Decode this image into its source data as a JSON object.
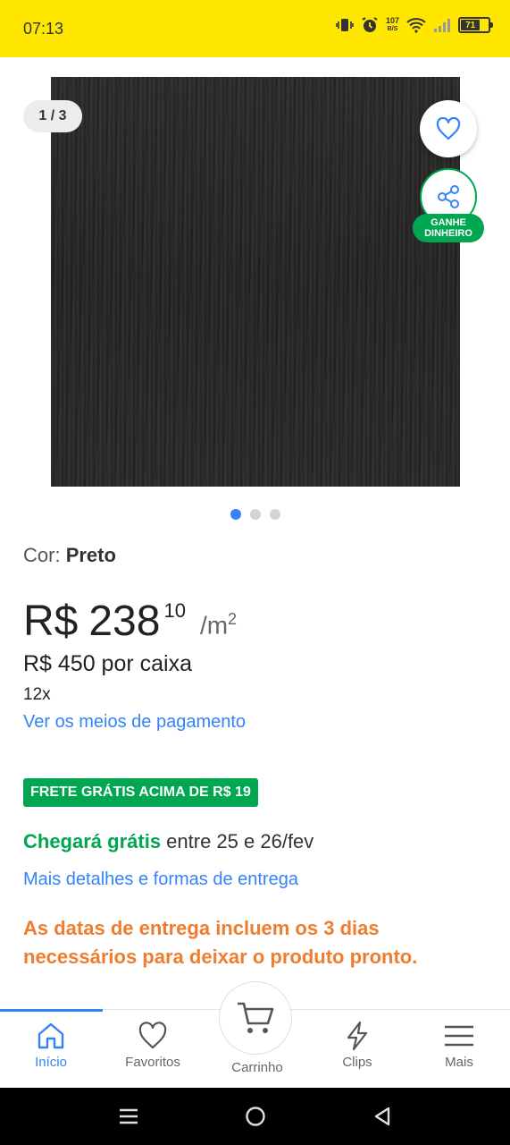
{
  "status_bar": {
    "time": "07:13",
    "net_speed_value": "107",
    "net_speed_unit": "B/S",
    "battery": "71",
    "icons": [
      "vibrate-icon",
      "alarm-icon",
      "wifi-icon",
      "signal-icon",
      "battery-icon"
    ]
  },
  "gallery": {
    "counter": "1 / 3",
    "image_count": 3,
    "active_index": 0,
    "share_badge_line1": "GANHE",
    "share_badge_line2": "DINHEIRO"
  },
  "product": {
    "color_label": "Cor:",
    "color_value": "Preto",
    "price_currency": "R$",
    "price_integer": "238",
    "price_cents": "10",
    "price_unit": "/m",
    "price_unit_exp": "2",
    "price_per_box": "R$ 450 por caixa",
    "installments": "12x",
    "payment_link": "Ver os meios de pagamento"
  },
  "shipping": {
    "badge": "FRETE GRÁTIS ACIMA DE R$ 19",
    "arrival_highlight": "Chegará grátis",
    "arrival_rest": " entre 25 e 26/fev",
    "details_link": "Mais detalhes e formas de entrega",
    "warning": "As datas de entrega incluem os 3 dias necessários para deixar o produto pronto."
  },
  "bottom_nav": {
    "items": [
      {
        "label": "Início",
        "icon": "home-icon"
      },
      {
        "label": "Favoritos",
        "icon": "heart-icon"
      },
      {
        "label": "Carrinho",
        "icon": "cart-icon"
      },
      {
        "label": "Clips",
        "icon": "lightning-icon"
      },
      {
        "label": "Mais",
        "icon": "menu-icon"
      }
    ],
    "active_index": 0
  },
  "colors": {
    "brand_yellow": "#ffe600",
    "link_blue": "#3483fa",
    "success_green": "#00a650",
    "warning_orange": "#f07d2e"
  }
}
